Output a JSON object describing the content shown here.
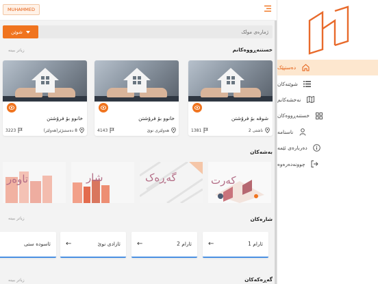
{
  "header": {
    "user": "MUHAMMED"
  },
  "search": {
    "button_label": "شوێن",
    "placeholder": "ژمارەی موڵک"
  },
  "sections": {
    "projects": {
      "title": "خستنەڕووەکانم",
      "see_more": "زیاتر ببینە"
    },
    "categories": {
      "title": "بەشەکان"
    },
    "cities": {
      "title": "شارەکان",
      "see_more": "زیاتر ببینە"
    },
    "neighborhoods": {
      "title": "گەڕەکەکان",
      "see_more": "زیاتر ببینە"
    }
  },
  "cards": [
    {
      "title": "خانوو بۆ فرۆشتن",
      "location": "8 دەستبژێر(هەولێر)",
      "area": "3223"
    },
    {
      "title": "خانوو بۆ فرۆشتن",
      "location": "هەولێری نوێ",
      "area": "4143"
    },
    {
      "title": "شوقە بۆ فرۆشتن",
      "location": "ناشتی 2",
      "area": "1381"
    }
  ],
  "categories": [
    {
      "label": "تاوەر"
    },
    {
      "label": "شار"
    },
    {
      "label": "گەڕەک"
    },
    {
      "label": "کەرت"
    }
  ],
  "cities": [
    {
      "label": "ئاسودە ستی"
    },
    {
      "label": "ئازادی نوێ"
    },
    {
      "label": "ئارام 2"
    },
    {
      "label": "ئارام 1"
    }
  ],
  "sidebar": {
    "items": [
      {
        "label": "دەستپێک",
        "icon": "home-icon"
      },
      {
        "label": "شوێنەکان",
        "icon": "list-icon"
      },
      {
        "label": "نەخشەکانم",
        "icon": "map-icon"
      },
      {
        "label": "خستنەڕووەکان",
        "icon": "grid-icon"
      },
      {
        "label": "ناسنامە",
        "icon": "user-icon"
      },
      {
        "label": "دەربارەی ئێمە",
        "icon": "info-icon"
      },
      {
        "label": "چوونەدەرەوە",
        "icon": "logout-icon"
      }
    ]
  },
  "colors": {
    "accent": "#f0741f",
    "active_bg": "#fde7cf",
    "city_border": "#4a90e2"
  }
}
